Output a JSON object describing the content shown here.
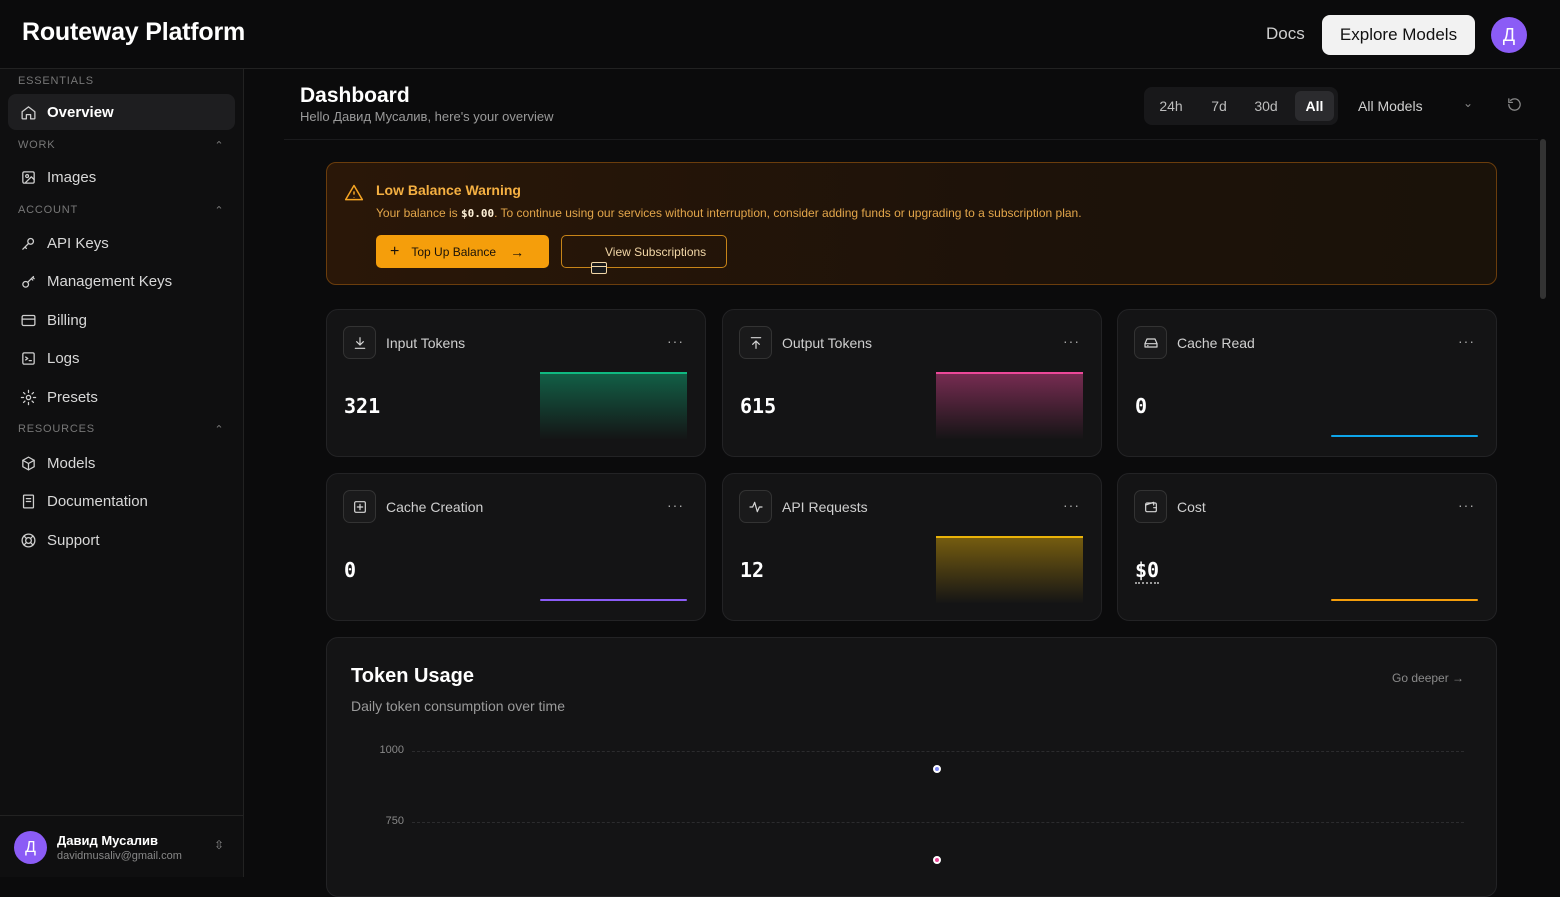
{
  "header": {
    "brand": "Routeway Platform",
    "docs_label": "Docs",
    "explore_label": "Explore Models",
    "avatar_initial": "Д"
  },
  "sidebar": {
    "sections": {
      "essentials": "ESSENTIALS",
      "work": "WORK",
      "account": "ACCOUNT",
      "resources": "RESOURCES"
    },
    "items": {
      "overview": "Overview",
      "images": "Images",
      "api_keys": "API Keys",
      "management_keys": "Management Keys",
      "billing": "Billing",
      "logs": "Logs",
      "presets": "Presets",
      "models": "Models",
      "documentation": "Documentation",
      "support": "Support"
    },
    "user": {
      "initial": "Д",
      "name": "Давид Мусалив",
      "email": "davidmusaliv@gmail.com"
    }
  },
  "dashboard": {
    "title": "Dashboard",
    "subtitle": "Hello Давид Мусалив, here's your overview",
    "ranges": [
      "24h",
      "7d",
      "30d",
      "All"
    ],
    "selected_range": "All",
    "model_filter": "All Models"
  },
  "warning": {
    "title": "Low Balance Warning",
    "text_before": "Your balance is ",
    "balance": "$0.00",
    "text_after": ". To continue using our services without interruption, consider adding funds or upgrading to a subscription plan.",
    "topup_label": "Top Up Balance",
    "subs_label": "View Subscriptions"
  },
  "stats": {
    "input_tokens": {
      "label": "Input Tokens",
      "value": "321",
      "color": "#10b981"
    },
    "output_tokens": {
      "label": "Output Tokens",
      "value": "615",
      "color": "#ec4899"
    },
    "cache_read": {
      "label": "Cache Read",
      "value": "0",
      "color": "#0ea5e9"
    },
    "cache_creation": {
      "label": "Cache Creation",
      "value": "0",
      "color": "#8b5cf6"
    },
    "api_requests": {
      "label": "API Requests",
      "value": "12",
      "color": "#eab308"
    },
    "cost": {
      "label": "Cost",
      "value": "$0",
      "color": "#f59e0b"
    },
    "more_label": "···"
  },
  "token_usage": {
    "title": "Token Usage",
    "subtitle": "Daily token consumption over time",
    "go_deeper": "Go deeper →",
    "y_ticks": [
      "1000",
      "750"
    ]
  },
  "chart_data": {
    "type": "scatter",
    "title": "Token Usage",
    "subtitle": "Daily token consumption over time",
    "y_ticks": [
      1000,
      750
    ],
    "series": [
      {
        "values": [
          935
        ],
        "color": "#818cf8"
      },
      {
        "values": [
          615
        ],
        "color": "#ec4899"
      }
    ]
  }
}
